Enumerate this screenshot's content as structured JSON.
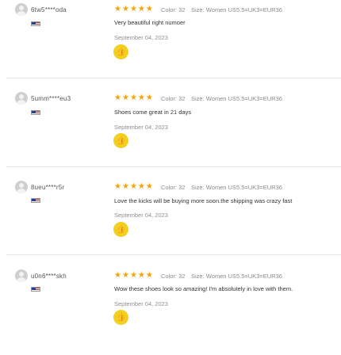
{
  "reviews": [
    {
      "username": "6tw5****oda",
      "rating": 5,
      "color": "Color: 32",
      "size": "Size: Women US5.5=UK3=EUR36",
      "content": "Very beautiful right numoer",
      "date": "September 04, 2023"
    },
    {
      "username": "5umm****eu3",
      "rating": 5,
      "color": "Color: 32",
      "size": "Size: Women US5.5=UK3=EUR36",
      "content": "Shoes come great in 21 days",
      "date": "September 04, 2023"
    },
    {
      "username": "8ueu****r5r",
      "rating": 5,
      "color": "Color: 32",
      "size": "Size: Women US5.5=UK3=EUR36",
      "content": "Love the kicks will be buying more soon.the shipping was crazy fast",
      "date": "September 04, 2023"
    },
    {
      "username": "u0n6****skh",
      "rating": 5,
      "color": "Color: 32",
      "size": "Size: Women US5.5=UK3=EUR36",
      "content": "Wow these shoes look so amazing! I'm absolutely in love with them.",
      "date": "September 04, 2023"
    }
  ],
  "star_glyph": "★",
  "like_icon": "thumbs-up-icon",
  "colors": {
    "star": "#f5a400",
    "like_button": "#f2d01f",
    "avatar": "#cfcfd1"
  }
}
